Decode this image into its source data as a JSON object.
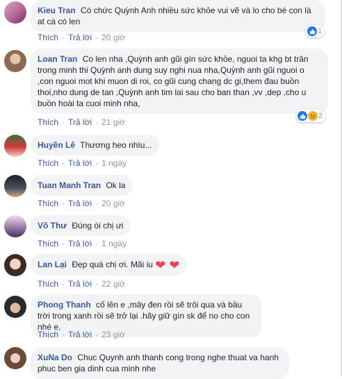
{
  "comments": [
    {
      "name": "Kieu Tran",
      "text": "Có chức Quỳnh Anh nhiều sức khỏe vui vẽ và lo cho bé con là at cà có len",
      "like_label": "Thích",
      "reply_label": "Trả lời",
      "time": "20 giờ",
      "reaction_count": "1"
    },
    {
      "name": "Loan Tran",
      "text": "Co len nha ,Quỳnh anh gũi gìn sức khỏe, nguoi ta khg bt trân trong minh thi Quỳnh anh dung suy nghi nua nha,Quỳnh anh gũi nguoi o ,con nguoi mot khi muon di roi, co gũi cung chang dc gi,them đau buồn thoi,nho dung de tan ,Quỳnh anh tim lai sau cho ban than ,vv ,dep ,cho u buồn hoài ta cuoi minh nha,",
      "like_label": "Thích",
      "reply_label": "Trả lời",
      "time": "21 giờ",
      "reaction_count": "2"
    },
    {
      "name": "Huyền Lê",
      "text": "Thương heo nhìu...",
      "like_label": "Thích",
      "reply_label": "Trả lời",
      "time": "1 ngày"
    },
    {
      "name": "Tuan Manh Tran",
      "text": "Ok la",
      "like_label": "Thích",
      "reply_label": "Trả lời",
      "time": "20 giờ"
    },
    {
      "name": "Võ Thư",
      "text": "Đúng òi chị ưi",
      "like_label": "Thích",
      "reply_label": "Trả lời",
      "time": "1 ngày"
    },
    {
      "name": "Lan Lại",
      "text": "Đẹp quá chị ơi. Mãi iu",
      "hearts": "❤ ❤",
      "like_label": "Thích",
      "reply_label": "Trả lời",
      "time": "22 giờ"
    },
    {
      "name": "Phong Thanh",
      "text": "cố lên e ,mây đen rồi sẽ trôi qua và bầu trời trong xanh rồi sẽ trở lại .hãy giữ gìn sk để no cho con nhé e.",
      "like_label": "Thích",
      "reply_label": "Trả lời",
      "time": "23 giờ"
    },
    {
      "name": "XuNa Do",
      "text": "Chuc Quynh anh thanh cong trong nghe thuat va hanh phuc ben gia dinh cua minh nhe"
    }
  ],
  "colors": {
    "name": "#385898",
    "bubble": "#f2f3f5",
    "meta": "#90949c",
    "like": "#1877f2"
  }
}
